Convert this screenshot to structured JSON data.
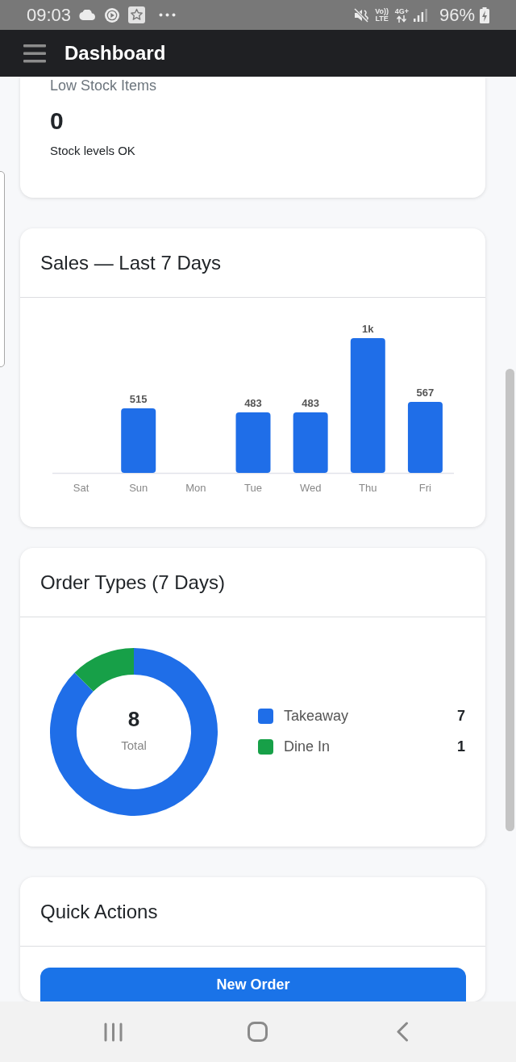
{
  "status_bar": {
    "time": "09:03",
    "volte": "Vo)) LTE",
    "network": "4G+",
    "battery": "96%"
  },
  "app_bar": {
    "title": "Dashboard"
  },
  "low_stock_card": {
    "label": "Low Stock Items",
    "value": "0",
    "note": "Stock levels OK"
  },
  "sales_card": {
    "title": "Sales — Last 7 Days",
    "chart_data": {
      "type": "bar",
      "categories": [
        "Sat",
        "Sun",
        "Mon",
        "Tue",
        "Wed",
        "Thu",
        "Fri"
      ],
      "values": [
        0,
        515,
        0,
        483,
        483,
        1075,
        567
      ],
      "value_labels": [
        null,
        "515",
        null,
        "483",
        "483",
        "1k",
        "567"
      ]
    }
  },
  "order_types_card": {
    "title": "Order Types (7 Days)",
    "chart_data": {
      "type": "donut",
      "categories": [
        "Takeaway",
        "Dine In"
      ],
      "values": [
        87.5,
        12.5
      ]
    },
    "total": "8",
    "total_label": "Total",
    "legend": [
      {
        "count": "7",
        "color": "#1f6ee8"
      },
      {
        "count": "1",
        "color": "#17a048"
      }
    ]
  },
  "quick_actions_card": {
    "title": "Quick Actions",
    "buttons": [
      {
        "label": "New Order"
      }
    ]
  }
}
